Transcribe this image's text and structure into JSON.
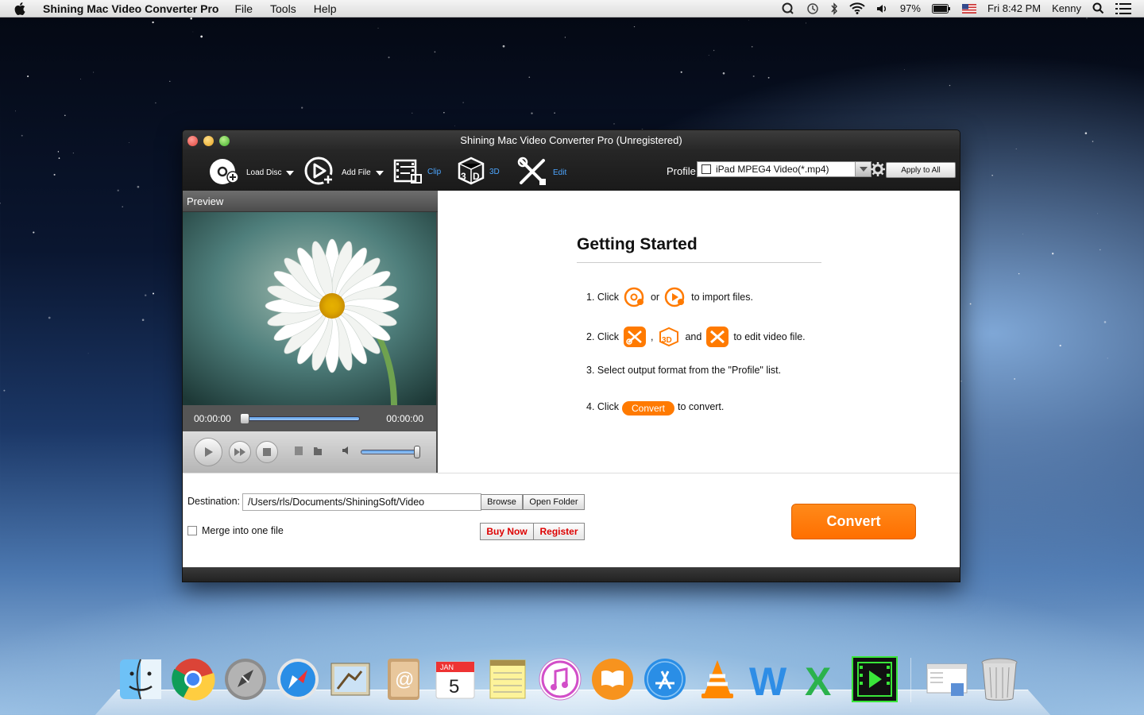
{
  "menubar": {
    "app_name": "Shining Mac Video Converter Pro",
    "menus": [
      "File",
      "Tools",
      "Help"
    ],
    "battery": "97%",
    "clock": "Fri 8:42 PM",
    "user": "Kenny",
    "icons": [
      "apple-icon",
      "spotlight-circle-icon",
      "time-machine-icon",
      "bluetooth-icon",
      "wifi-icon",
      "volume-icon",
      "battery-icon",
      "us-flag-icon",
      "search-icon",
      "list-icon"
    ]
  },
  "window": {
    "title": "Shining Mac Video Converter Pro (Unregistered)",
    "toolbar": {
      "load_disc": "Load Disc",
      "add_file": "Add File",
      "clip": "Clip",
      "three_d": "3D",
      "edit": "Edit"
    },
    "profile": {
      "label": "Profile",
      "value": "iPad MPEG4 Video(*.mp4)",
      "apply_all": "Apply to All"
    },
    "preview": {
      "header": "Preview",
      "time_current": "00:00:00",
      "time_total": "00:00:00"
    },
    "getting_started": {
      "title": "Getting Started",
      "step1_a": "1. Click",
      "step1_or": "or",
      "step1_b": "to import files.",
      "step2_a": "2. Click",
      "step2_comma": ",",
      "step2_and": "and",
      "step2_b": "to edit video file.",
      "step3": "3. Select output format from the \"Profile\" list.",
      "step4_a": "4. Click",
      "step4_btn": "Convert",
      "step4_b": "to convert."
    },
    "bottom": {
      "destination_label": "Destination:",
      "destination_value": "/Users/rls/Documents/ShiningSoft/Video",
      "browse": "Browse",
      "open_folder": "Open Folder",
      "merge_label": "Merge into one file",
      "buy_now": "Buy Now",
      "register": "Register",
      "convert": "Convert"
    }
  },
  "dock": {
    "items": [
      "finder-icon",
      "chrome-icon",
      "launchpad-icon",
      "safari-icon",
      "mail-icon",
      "contacts-icon",
      "calendar-icon",
      "notes-icon",
      "itunes-icon",
      "ibooks-icon",
      "app-store-icon",
      "vlc-icon",
      "word-icon",
      "excel-icon",
      "video-converter-icon",
      "downloads-icon",
      "trash-icon"
    ],
    "calendar_month": "JAN",
    "calendar_day": "5"
  },
  "colors": {
    "accent_orange": "#ff7a00",
    "window_dark": "#2c2c2c",
    "link_blue": "#4da6ff",
    "register_red": "#dd0000"
  }
}
